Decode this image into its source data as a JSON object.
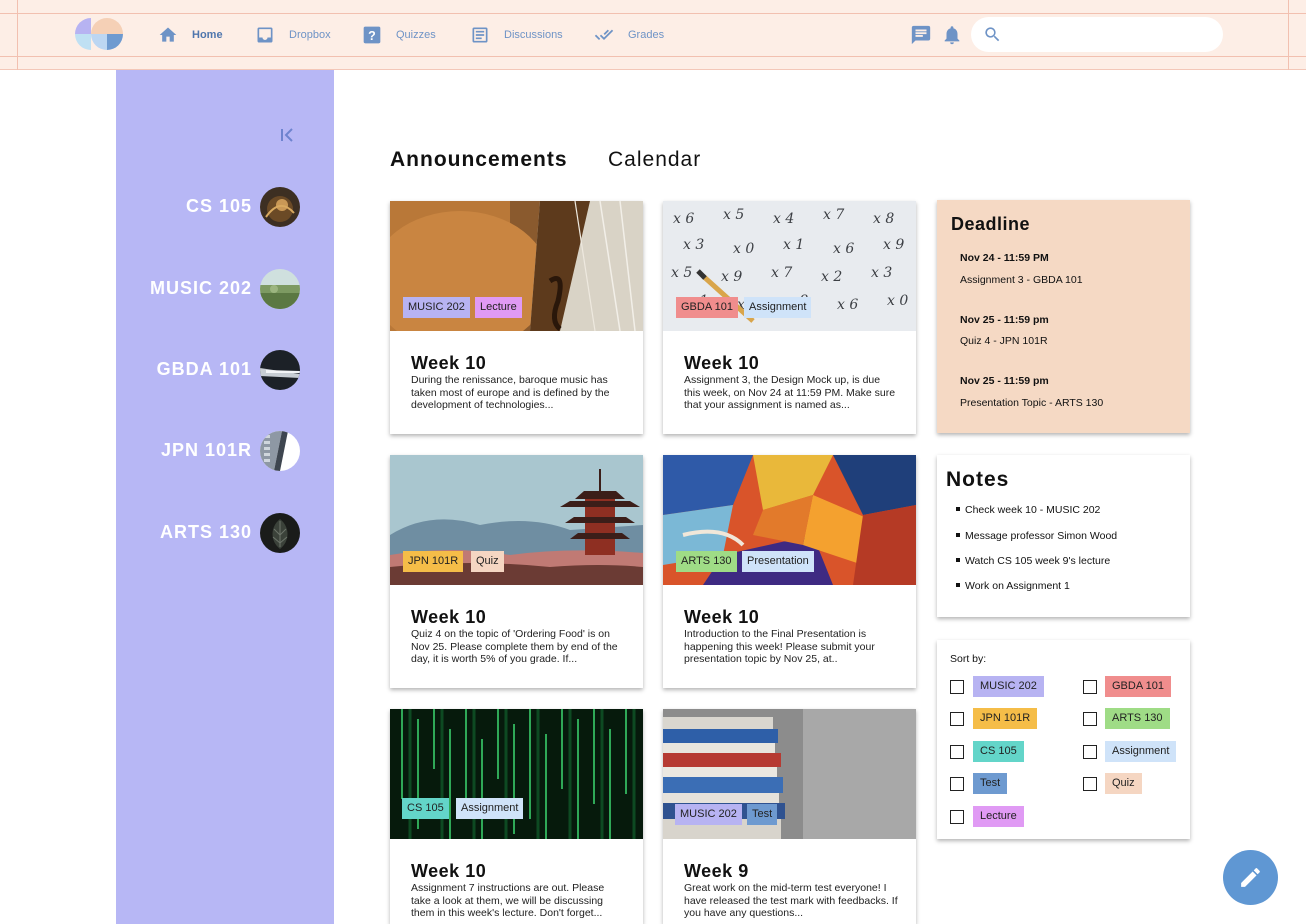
{
  "nav": {
    "items": [
      {
        "label": "Home",
        "icon": "home-icon",
        "active": true
      },
      {
        "label": "Dropbox",
        "icon": "inbox-icon"
      },
      {
        "label": "Quizzes",
        "icon": "question-icon"
      },
      {
        "label": "Discussions",
        "icon": "discussion-icon"
      },
      {
        "label": "Grades",
        "icon": "double-check-icon"
      }
    ],
    "search_placeholder": "",
    "right_icons": [
      "chat-icon",
      "bell-icon",
      "search-icon"
    ]
  },
  "sidebar": {
    "collapse_icon": "collapse-left-icon",
    "courses": [
      {
        "name": "CS 105"
      },
      {
        "name": "MUSIC 202"
      },
      {
        "name": "GBDA 101"
      },
      {
        "name": "JPN 101R"
      },
      {
        "name": "ARTS 130"
      }
    ]
  },
  "tabs": [
    "Announcements",
    "Calendar"
  ],
  "cards": [
    {
      "chips": [
        "MUSIC 202",
        "Lecture"
      ],
      "title": "Week 10",
      "body": "During the renissance, baroque music has taken most of europe and is defined by the development of technologies..."
    },
    {
      "chips": [
        "GBDA 101",
        "Assignment"
      ],
      "title": "Week 10",
      "body": "Assignment 3, the Design Mock up, is due this week, on Nov 24 at 11:59 PM. Make sure that your assignment is named as..."
    },
    {
      "chips": [
        "JPN 101R",
        "Quiz"
      ],
      "title": "Week 10",
      "body": "Quiz 4 on the topic of 'Ordering Food' is on Nov 25. Please complete them by end of the day, it is worth 5% of you grade. If..."
    },
    {
      "chips": [
        "ARTS 130",
        "Presentation"
      ],
      "title": "Week 10",
      "body": "Introduction to the Final Presentation is happening this week! Please submit your presentation topic by Nov 25, at.."
    },
    {
      "chips": [
        "CS 105",
        "Assignment"
      ],
      "title": "Week 10",
      "body": "Assignment 7 instructions are out. Please take a look at them, we will be discussing them in this week's lecture. Don't forget..."
    },
    {
      "chips": [
        "MUSIC 202",
        "Test"
      ],
      "title": "Week 9",
      "body": "Great work on the mid-term test everyone! I have released the test mark with feedbacks. If you have any questions..."
    }
  ],
  "deadline": {
    "title": "Deadline",
    "items": [
      {
        "date": "Nov 24 - 11:59 PM",
        "text": "Assignment 3 - GBDA 101"
      },
      {
        "date": "Nov 25 - 11:59 pm",
        "text": "Quiz 4 - JPN 101R"
      },
      {
        "date": "Nov 25 - 11:59 pm",
        "text": "Presentation Topic - ARTS 130"
      }
    ]
  },
  "notes": {
    "title": "Notes",
    "items": [
      "Check week 10 - MUSIC 202",
      "Message professor Simon Wood",
      "Watch CS 105 week 9's lecture",
      "Work on Assignment 1"
    ]
  },
  "sort": {
    "label": "Sort by:",
    "options": [
      {
        "label": "MUSIC 202",
        "color": "#b7b3f2",
        "checked": false
      },
      {
        "label": "GBDA 101",
        "color": "#f08d8d",
        "checked": false
      },
      {
        "label": "JPN 101R",
        "color": "#f5bd48",
        "checked": false
      },
      {
        "label": "ARTS 130",
        "color": "#9fdc86",
        "checked": false
      },
      {
        "label": "CS 105",
        "color": "#63d5c9",
        "checked": false
      },
      {
        "label": "Assignment",
        "color": "#cfe3f9",
        "checked": false
      },
      {
        "label": "Test",
        "color": "#6e9ad0",
        "checked": false
      },
      {
        "label": "Quiz",
        "color": "#f5d6c2",
        "checked": false
      },
      {
        "label": "Lecture",
        "color": "#e09af4",
        "checked": false
      }
    ]
  },
  "tag_colors": {
    "MUSIC 202": "#b7b3f2",
    "GBDA 101": "#f08d8d",
    "JPN 101R": "#f5bd48",
    "ARTS 130": "#9fdc86",
    "CS 105": "#63d5c9",
    "Assignment": "#cfe3f9",
    "Test": "#6e9ad0",
    "Quiz": "#f5d6c2",
    "Lecture": "#e09af4",
    "Presentation": "#cfe3f9"
  },
  "fab": {
    "icon": "pencil-icon"
  }
}
